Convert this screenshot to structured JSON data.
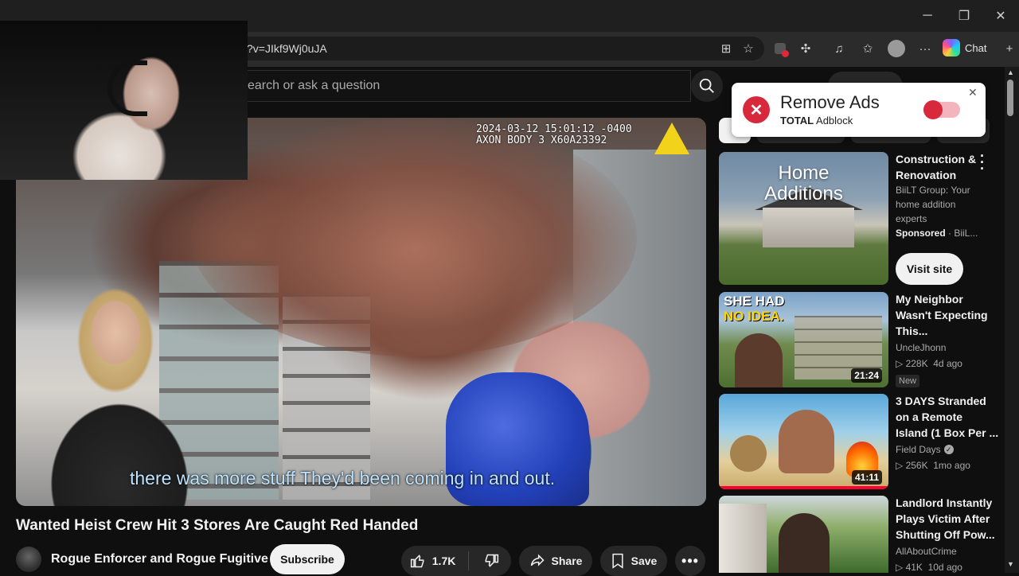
{
  "browser": {
    "url_fragment": "?v=JIkf9Wj0uJA",
    "chat_label": "Chat"
  },
  "youtube": {
    "search_placeholder": "earch or ask a question"
  },
  "player": {
    "timestamp_line1": "2024-03-12 15:01:12 -0400",
    "timestamp_line2": "AXON BODY 3 X60A23392",
    "caption": "there was more stuff They'd been coming in and out."
  },
  "video": {
    "title": "Wanted Heist Crew Hit 3 Stores Are Caught Red Handed",
    "channel": "Rogue Enforcer and Rogue Fugitive",
    "subscribe_label": "Subscribe",
    "likes": "1.7K",
    "share_label": "Share",
    "save_label": "Save"
  },
  "adblock": {
    "title": "Remove Ads",
    "brand_bold": "TOTAL",
    "brand_rest": " Adblock"
  },
  "sidebar": {
    "ad": {
      "overlay_text_line1": "Home",
      "overlay_text_line2": "Additions",
      "title_line1": "Construction &",
      "title_line2": "Renovation",
      "desc_line1": "BiiLT Group: Your",
      "desc_line2": "home addition",
      "desc_line3": "experts",
      "sponsored": "Sponsored",
      "advertiser": " · BiiL...",
      "cta": "Visit site"
    },
    "items": [
      {
        "title_line1": "My Neighbor",
        "title_line2": "Wasn't Expecting",
        "title_line3": "This...",
        "channel": "UncleJhonn",
        "meta": "228K  4d ago",
        "badge": "New",
        "duration": "21:24",
        "thumb_text_line1": "SHE HAD",
        "thumb_text_line2": "NO IDEA."
      },
      {
        "title_line1": "3 DAYS Stranded",
        "title_line2": "on a Remote",
        "title_line3": "Island (1 Box Per ...",
        "channel": "Field Days",
        "meta": "256K  1mo ago",
        "duration": "41:11"
      },
      {
        "title_line1": "Landlord Instantly",
        "title_line2": "Plays Victim After",
        "title_line3": "Shutting Off Pow...",
        "channel": "AllAboutCrime",
        "meta": "41K  10d ago"
      }
    ]
  }
}
